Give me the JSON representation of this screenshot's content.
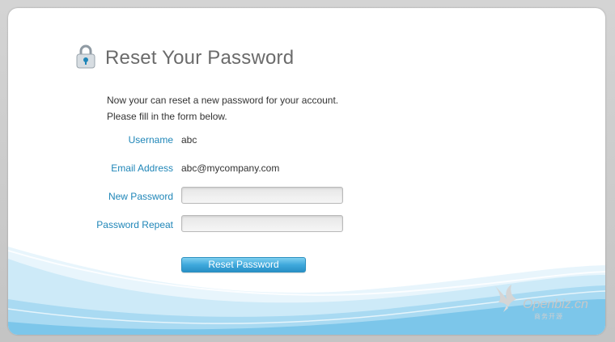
{
  "page": {
    "title": "Reset Your Password"
  },
  "intro": {
    "line1": "Now your can reset a new password for your account.",
    "line2": "Please fill in the form below."
  },
  "form": {
    "username_label": "Username",
    "username_value": "abc",
    "email_label": "Email Address",
    "email_value": "abc@mycompany.com",
    "new_password_label": "New Password",
    "new_password_value": "",
    "password_repeat_label": "Password Repeat",
    "password_repeat_value": "",
    "submit_label": "Reset Password"
  },
  "brand": {
    "name": "Openbiz.cn",
    "sub": "商务开源"
  },
  "colors": {
    "label": "#1f86b8",
    "title": "#6b6b6b",
    "button": "#3fa9dc",
    "wave": "#bfe3f5"
  },
  "icons": {
    "title_icon": "lock-icon",
    "brand_icon": "bird-logo-icon"
  }
}
